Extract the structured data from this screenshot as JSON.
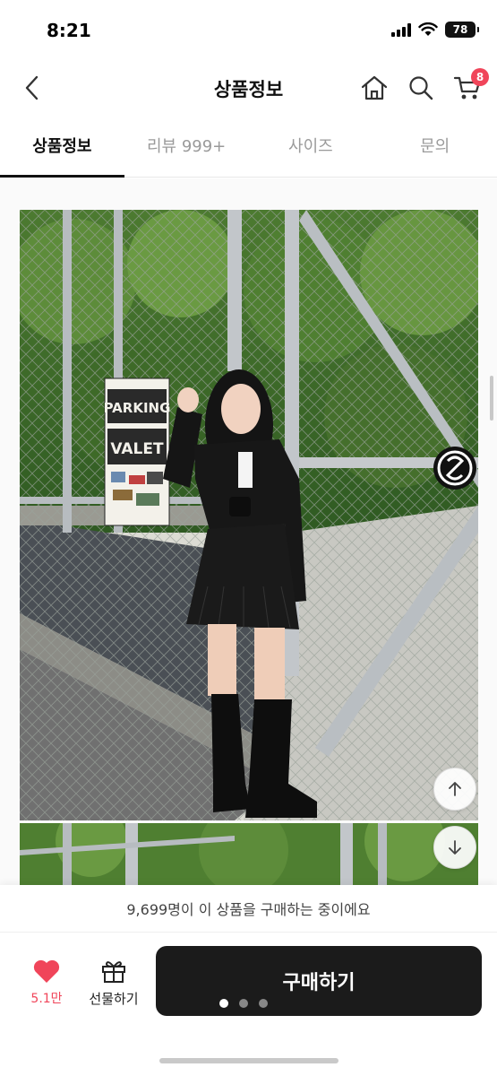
{
  "status_bar": {
    "time": "8:21",
    "battery": "78"
  },
  "header": {
    "title": "상품정보",
    "cart_count": "8"
  },
  "tabs": [
    {
      "label": "상품정보",
      "active": true
    },
    {
      "label": "리뷰 999+",
      "active": false
    },
    {
      "label": "사이즈",
      "active": false
    },
    {
      "label": "문의",
      "active": false
    }
  ],
  "product_photo": {
    "sign_line1": "PARKING",
    "sign_line2": "VALET"
  },
  "bottom_bar": {
    "purchase_notice": "9,699명이 이 상품을 구매하는 중이에요",
    "like_count": "5.1만",
    "gift_label": "선물하기",
    "buy_label": "구매하기",
    "carousel_pages": 3,
    "carousel_active": 0
  },
  "colors": {
    "accent": "#f0455a",
    "buy_button": "#1b1b1b",
    "tab_inactive": "#9a9a9a"
  }
}
